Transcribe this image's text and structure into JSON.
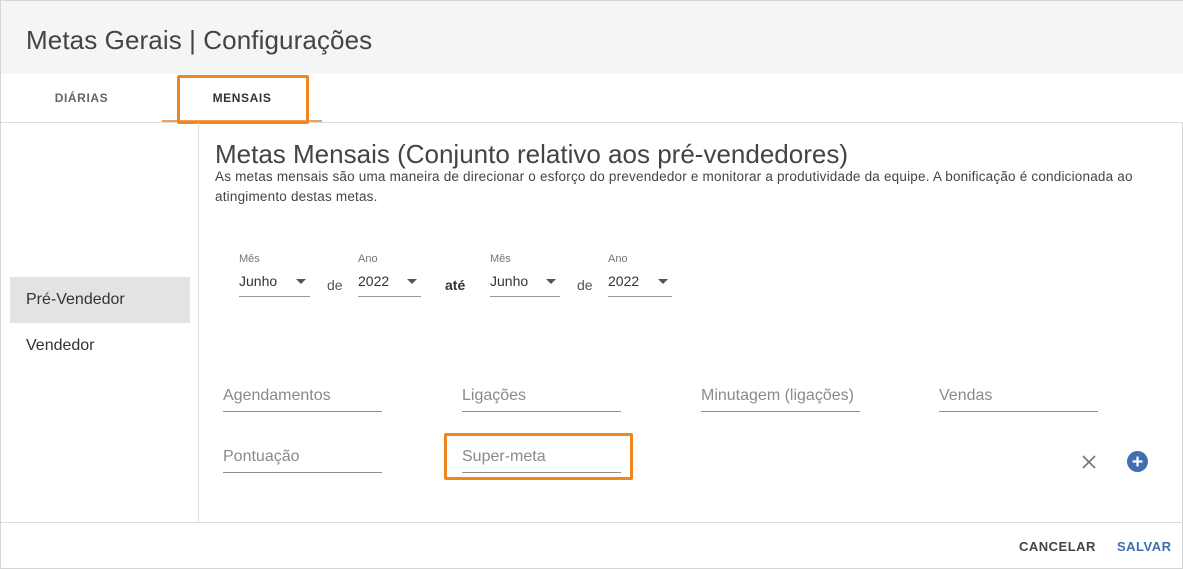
{
  "dialog": {
    "title": "Metas Gerais | Configurações"
  },
  "tabs": [
    {
      "label": "DIÁRIAS",
      "active": false
    },
    {
      "label": "MENSAIS",
      "active": true
    }
  ],
  "sidebar": {
    "items": [
      {
        "label": "Pré-Vendedor",
        "active": true
      },
      {
        "label": "Vendedor",
        "active": false
      }
    ]
  },
  "main": {
    "title": "Metas Mensais (Conjunto relativo aos pré-vendedores)",
    "description": "As metas mensais são uma maneira de direcionar o esforço do prevendedor e monitorar a produtividade da equipe. A bonificação é condicionada ao atingimento destas metas."
  },
  "period": {
    "start_month": {
      "label": "Mês",
      "value": "Junho"
    },
    "sep_de_1": "de",
    "start_year": {
      "label": "Ano",
      "value": "2022"
    },
    "sep_ate": "até",
    "end_month": {
      "label": "Mês",
      "value": "Junho"
    },
    "sep_de_2": "de",
    "end_year": {
      "label": "Ano",
      "value": "2022"
    }
  },
  "fields": {
    "agendamentos": {
      "placeholder": "Agendamentos",
      "value": ""
    },
    "ligacoes": {
      "placeholder": "Ligações",
      "value": ""
    },
    "minutagem": {
      "placeholder": "Minutagem (ligações)",
      "value": ""
    },
    "vendas": {
      "placeholder": "Vendas",
      "value": ""
    },
    "pontuacao": {
      "placeholder": "Pontuação",
      "value": ""
    },
    "super_meta": {
      "placeholder": "Super-meta",
      "value": ""
    }
  },
  "icons": {
    "clear": "close-icon",
    "add": "plus-circle-icon"
  },
  "footer": {
    "cancel_label": "CANCELAR",
    "save_label": "SALVAR"
  },
  "colors": {
    "accent": "#3f6eb1",
    "highlight": "#f08522",
    "tab_ink": "#f0a058"
  }
}
